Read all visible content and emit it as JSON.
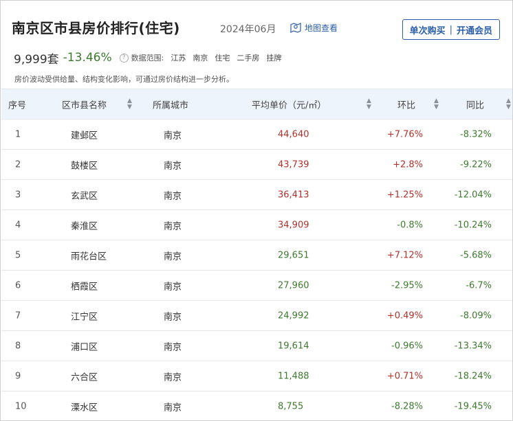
{
  "header": {
    "title": "南京区市县房价排行(住宅)",
    "date": "2024年06月",
    "map_link": "地图查看",
    "buy_label": "单次购买",
    "member_label": "开通会员",
    "separator": "|"
  },
  "stats": {
    "count": "9,999套",
    "change": "-13.46%",
    "help": "?",
    "scope_label": "数据范围:",
    "scope_items": [
      "江苏",
      "南京",
      "住宅",
      "二手房",
      "挂牌"
    ]
  },
  "note": "房价波动受供给量、结构变化影响，可通过房价结构进一步分析。",
  "table": {
    "headers": {
      "index": "序号",
      "name": "区市县名称",
      "city": "所属城市",
      "price": "平均单价（元/㎡）",
      "mom": "环比",
      "yoy": "同比"
    },
    "rows": [
      {
        "index": "1",
        "name": "建邺区",
        "city": "南京",
        "price": "44,640",
        "mom": "+7.76%",
        "yoy": "-8.32%"
      },
      {
        "index": "2",
        "name": "鼓楼区",
        "city": "南京",
        "price": "43,739",
        "mom": "+2.8%",
        "yoy": "-9.22%"
      },
      {
        "index": "3",
        "name": "玄武区",
        "city": "南京",
        "price": "36,413",
        "mom": "+1.25%",
        "yoy": "-12.04%"
      },
      {
        "index": "4",
        "name": "秦淮区",
        "city": "南京",
        "price": "34,909",
        "mom": "-0.8%",
        "yoy": "-10.24%"
      },
      {
        "index": "5",
        "name": "雨花台区",
        "city": "南京",
        "price": "29,651",
        "mom": "+7.12%",
        "yoy": "-5.68%"
      },
      {
        "index": "6",
        "name": "栖霞区",
        "city": "南京",
        "price": "27,960",
        "mom": "-2.95%",
        "yoy": "-6.7%"
      },
      {
        "index": "7",
        "name": "江宁区",
        "city": "南京",
        "price": "24,992",
        "mom": "+0.49%",
        "yoy": "-8.09%"
      },
      {
        "index": "8",
        "name": "浦口区",
        "city": "南京",
        "price": "19,614",
        "mom": "-0.96%",
        "yoy": "-13.34%"
      },
      {
        "index": "9",
        "name": "六合区",
        "city": "南京",
        "price": "11,488",
        "mom": "+0.71%",
        "yoy": "-18.24%"
      },
      {
        "index": "10",
        "name": "溧水区",
        "city": "南京",
        "price": "8,755",
        "mom": "-8.28%",
        "yoy": "-19.45%"
      }
    ]
  },
  "colors": {
    "accent": "#2a5ea8",
    "up": "#b0302a",
    "down": "#3c7a2e",
    "header_bg": "#eef4fb"
  }
}
